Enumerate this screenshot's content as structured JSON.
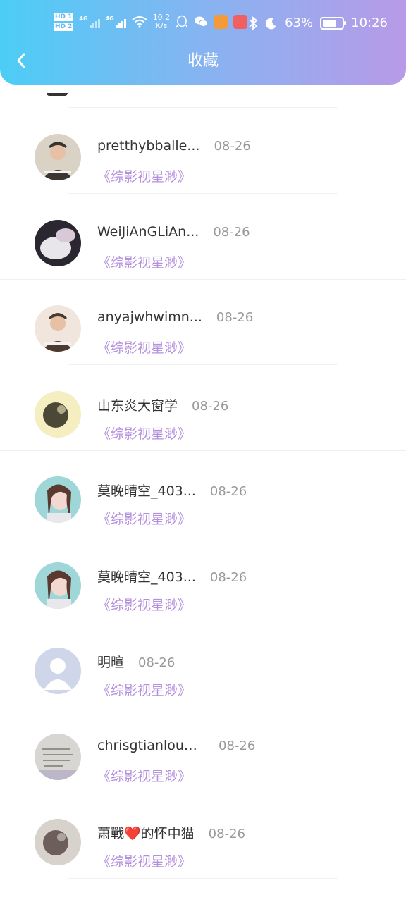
{
  "status_bar": {
    "hd1": "HD 1",
    "hd2": "HD 2",
    "sig1_tag": "4G",
    "sig2_tag": "4G",
    "net_speed_top": "10.2",
    "net_speed_bottom": "K/s",
    "battery": "63%",
    "time": "10:26"
  },
  "header": {
    "title": "收藏"
  },
  "favorites": [
    {
      "name": "pretthybballe...",
      "date": "08-26",
      "book": "《综影视星渺》",
      "avatar": "photo-avatar",
      "colors": [
        "#3a3530",
        "#d9d2c5"
      ]
    },
    {
      "name": "WeiJiAnGLiAn...",
      "date": "08-26",
      "book": "《综影视星渺》",
      "avatar": "cat-avatar",
      "colors": [
        "#2a2730",
        "#e8e6ea"
      ]
    },
    {
      "name": "anyajwhwimn...",
      "date": "08-26",
      "book": "《综影视星渺》",
      "avatar": "photo-avatar",
      "colors": [
        "#4b3a30",
        "#f0e6de"
      ]
    },
    {
      "name": "山东炎大窗学",
      "date": "08-26",
      "book": "《综影视星渺》",
      "avatar": "art-avatar",
      "colors": [
        "#f5eec0",
        "#2d2a20"
      ]
    },
    {
      "name": "莫晚晴空_403...",
      "date": "08-26",
      "book": "《综影视星渺》",
      "avatar": "girl-avatar",
      "colors": [
        "#9fd7d9",
        "#f3d8d2"
      ]
    },
    {
      "name": "莫晚晴空_403...",
      "date": "08-26",
      "book": "《综影视星渺》",
      "avatar": "girl-avatar",
      "colors": [
        "#9fd7d9",
        "#f3d8d2"
      ]
    },
    {
      "name": "明暄",
      "date": "08-26",
      "book": "《综影视星渺》",
      "avatar": "default-user-avatar",
      "colors": [
        "#cfd6ea",
        "#ffffff"
      ]
    },
    {
      "name": "chrisgtianloub...",
      "date": "08-26",
      "book": "《综影视星渺》",
      "avatar": "text-avatar",
      "colors": [
        "#d8d6d3",
        "#6a6560"
      ]
    },
    {
      "name": "萧戰❤️的怀中猫",
      "date": "08-26",
      "book": "《综影视星渺》",
      "avatar": "art-avatar",
      "colors": [
        "#d8d2cc",
        "#5a4a48"
      ]
    }
  ]
}
